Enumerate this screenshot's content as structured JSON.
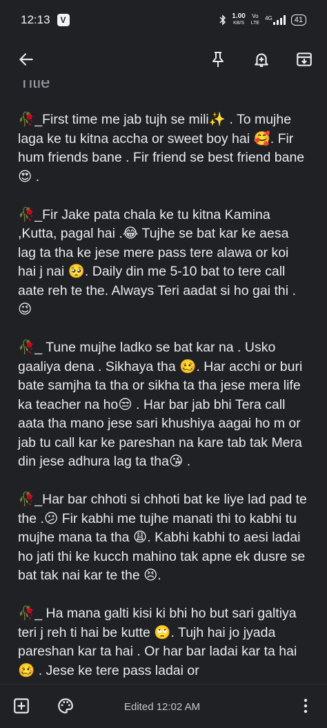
{
  "status": {
    "time": "12:13",
    "app_badge": "V",
    "net_speed_value": "1.00",
    "net_speed_unit": "KB/S",
    "net_type": "4G",
    "vo_label": "Vo",
    "lte_label": "LTE",
    "battery": "41"
  },
  "toolbar": {
    "icons": [
      "back-arrow-icon",
      "pin-icon",
      "reminder-bell-icon",
      "archive-icon"
    ]
  },
  "note": {
    "title": "Title",
    "paragraphs": [
      "🥀_First time me jab tujh se mili✨ . To mujhe laga ke tu kitna accha or sweet boy hai 🥰. Fir hum friends bane . Fir friend se best friend bane😍 .",
      "🥀_Fir Jake pata chala ke tu kitna Kamina ,Kutta, pagal hai .😂 Tujhe se bat kar ke aesa lag ta tha ke jese mere pass tere alawa or koi hai j nai 🥺. Daily din me 5-10 bat to tere call aate reh te the. Always Teri aadat si ho gai thi .😉",
      "🥀_ Tune mujhe ladko se bat kar na . Usko gaaliya dena . Sikhaya tha 🥴. Har acchi or buri bate samjha ta tha or sikha ta tha jese mera life ka teacher na ho😒 . Har bar jab bhi Tera call aata tha mano jese sari khushiya aagai ho m or jab tu call kar ke pareshan na kare tab tak Mera din  jese adhura lag ta tha😘 .",
      "🥀_Har bar chhoti si chhoti bat ke liye lad pad te the .😕 Fir kabhi me tujhe manati thi to kabhi tu mujhe mana ta tha 😩. Kabhi kabhi to aesi ladai ho jati thi ke kucch mahino tak apne ek dusre se bat tak nai kar te the 😣.",
      "🥀_ Ha mana galti kisi ki bhi ho but sari galtiya teri j reh ti hai be kutte 🙄. Tujh hai jo jyada pareshan kar ta hai . Or har bar ladai kar ta hai 🥴 . Jese ke tere pass ladai or"
    ]
  },
  "bottom_bar": {
    "edited_label": "Edited 12:02 AM",
    "icons": [
      "add-box-icon",
      "palette-icon",
      "more-vert-icon"
    ]
  }
}
